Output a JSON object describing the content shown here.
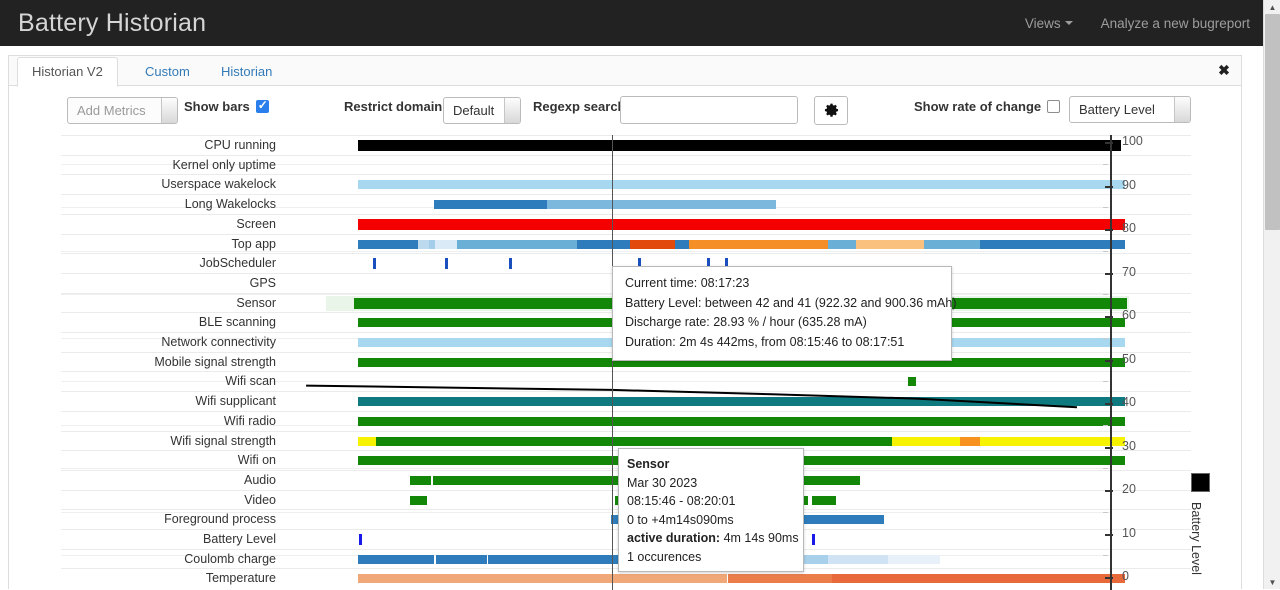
{
  "navbar": {
    "brand": "Battery Historian",
    "views_label": "Views",
    "analyze_label": "Analyze a new bugreport"
  },
  "tabs": [
    {
      "label": "Historian V2",
      "active": true
    },
    {
      "label": "Custom",
      "active": false
    },
    {
      "label": "Historian",
      "active": false
    }
  ],
  "close_label": "✖",
  "toolbar": {
    "add_metrics_label": "Add Metrics",
    "show_bars_label": "Show bars",
    "show_bars_checked": true,
    "restrict_domain_label": "Restrict domain",
    "restrict_domain_value": "Default",
    "regexp_search_label": "Regexp search",
    "regexp_search_value": "",
    "regexp_search_placeholder": "",
    "settings_icon": "gear-icon",
    "show_rate_label": "Show rate of change",
    "show_rate_checked": false,
    "metric_select_value": "Battery Level"
  },
  "legend": {
    "series_label": "Battery Level",
    "swatch_color": "#000000"
  },
  "tooltip_time": {
    "lines": [
      "Current time: 08:17:23",
      "Battery Level: between 42 and 41 (922.32 and 900.36 mAh)",
      "Discharge rate: 28.93 % / hour (635.28 mA)",
      "Duration: 2m 4s 442ms, from 08:15:46 to 08:17:51"
    ]
  },
  "tooltip_sensor": {
    "title": "Sensor",
    "date": "Mar 30 2023",
    "range": "08:15:46 - 08:20:01",
    "offset": "0 to +4m14s090ms",
    "active_duration_label": "active duration:",
    "active_duration_value": "4m 14s 90ms",
    "occurrences": "1 occurences"
  },
  "chart_data": {
    "type": "timeline",
    "title": "Battery Historian V2 timeline",
    "date": "Mar 30 2023",
    "current_time": "08:17:23",
    "cursor_time": "08:17:23",
    "yaxis": {
      "label": "Battery Level",
      "ticks": [
        100,
        90,
        80,
        70,
        60,
        50,
        40,
        30,
        20,
        10,
        0
      ],
      "ylim": [
        0,
        100
      ],
      "grid": true
    },
    "battery_level_series": {
      "name": "Battery Level",
      "color": "#000000",
      "points": [
        {
          "x": 0.04,
          "level": 44
        },
        {
          "x": 0.42,
          "level": 43
        },
        {
          "x": 0.62,
          "level": 42
        },
        {
          "x": 0.8,
          "level": 41
        },
        {
          "x": 1.0,
          "level": 39
        }
      ]
    },
    "rows": [
      {
        "label": "CPU running",
        "segments": [
          {
            "start": 0.04,
            "end": 0.99,
            "color": "#000000",
            "tall": true
          }
        ]
      },
      {
        "label": "Kernel only uptime",
        "segments": []
      },
      {
        "label": "Userspace wakelock",
        "segments": [
          {
            "start": 0.04,
            "end": 0.995,
            "color": "#a8d8f0"
          }
        ]
      },
      {
        "label": "Long Wakelocks",
        "segments": [
          {
            "start": 0.135,
            "end": 0.275,
            "color": "#2e7cbb"
          },
          {
            "start": 0.275,
            "end": 0.56,
            "color": "#7cb8dd"
          }
        ]
      },
      {
        "label": "Screen",
        "segments": [
          {
            "start": 0.04,
            "end": 0.995,
            "color": "#f40000",
            "tall": true
          }
        ]
      },
      {
        "label": "Top app",
        "segments": [
          {
            "start": 0.04,
            "end": 0.115,
            "color": "#2e7cbb"
          },
          {
            "start": 0.115,
            "end": 0.128,
            "color": "#bcd9ee"
          },
          {
            "start": 0.128,
            "end": 0.136,
            "color": "#a3cde8"
          },
          {
            "start": 0.136,
            "end": 0.163,
            "color": "#dbeaf7"
          },
          {
            "start": 0.163,
            "end": 0.313,
            "color": "#6aafd6"
          },
          {
            "start": 0.313,
            "end": 0.378,
            "color": "#2e7cbb"
          },
          {
            "start": 0.378,
            "end": 0.435,
            "color": "#e24a0d"
          },
          {
            "start": 0.435,
            "end": 0.452,
            "color": "#2e7cbb"
          },
          {
            "start": 0.452,
            "end": 0.625,
            "color": "#f58e27"
          },
          {
            "start": 0.625,
            "end": 0.66,
            "color": "#6aafd6"
          },
          {
            "start": 0.66,
            "end": 0.745,
            "color": "#fac07d"
          },
          {
            "start": 0.745,
            "end": 0.815,
            "color": "#6aafd6"
          },
          {
            "start": 0.815,
            "end": 0.995,
            "color": "#2e7cbb"
          }
        ]
      },
      {
        "label": "JobScheduler",
        "segments": [
          {
            "start": 0.059,
            "end": 0.062,
            "color": "#1a4fbe",
            "tick": true
          },
          {
            "start": 0.148,
            "end": 0.151,
            "color": "#1a4fbe",
            "tick": true
          },
          {
            "start": 0.228,
            "end": 0.236,
            "color": "#1a4fbe",
            "tick": true
          },
          {
            "start": 0.388,
            "end": 0.391,
            "color": "#1a4fbe",
            "tick": true
          },
          {
            "start": 0.474,
            "end": 0.477,
            "color": "#1a4fbe",
            "tick": true
          },
          {
            "start": 0.497,
            "end": 0.5,
            "color": "#1a4fbe",
            "tick": true
          }
        ]
      },
      {
        "label": "GPS",
        "segments": [
          {
            "start": 0.575,
            "end": 0.655,
            "color": "#f40000"
          }
        ]
      },
      {
        "label": "Sensor",
        "segments": [
          {
            "start": 0.035,
            "end": 0.997,
            "color": "#138808",
            "tall": true
          }
        ],
        "highlighted": true
      },
      {
        "label": "BLE scanning",
        "segments": [
          {
            "start": 0.04,
            "end": 0.995,
            "color": "#138808"
          }
        ]
      },
      {
        "label": "Network connectivity",
        "segments": [
          {
            "start": 0.04,
            "end": 0.995,
            "color": "#a8d8f0"
          }
        ]
      },
      {
        "label": "Mobile signal strength",
        "segments": [
          {
            "start": 0.04,
            "end": 0.995,
            "color": "#138808"
          }
        ]
      },
      {
        "label": "Wifi scan",
        "segments": [
          {
            "start": 0.725,
            "end": 0.735,
            "color": "#138808"
          }
        ]
      },
      {
        "label": "Wifi supplicant",
        "segments": [
          {
            "start": 0.04,
            "end": 0.5,
            "color": "#f40000"
          },
          {
            "start": 0.04,
            "end": 0.995,
            "color": "#0e7a80"
          }
        ]
      },
      {
        "label": "Wifi radio",
        "segments": [
          {
            "start": 0.04,
            "end": 0.995,
            "color": "#138808"
          }
        ]
      },
      {
        "label": "Wifi signal strength",
        "segments": [
          {
            "start": 0.04,
            "end": 0.062,
            "color": "#f7f200"
          },
          {
            "start": 0.062,
            "end": 0.705,
            "color": "#138808"
          },
          {
            "start": 0.705,
            "end": 0.79,
            "color": "#f7f200"
          },
          {
            "start": 0.79,
            "end": 0.815,
            "color": "#f79221"
          },
          {
            "start": 0.815,
            "end": 0.995,
            "color": "#f7f200"
          }
        ]
      },
      {
        "label": "Wifi on",
        "segments": [
          {
            "start": 0.04,
            "end": 0.995,
            "color": "#138808"
          }
        ]
      },
      {
        "label": "Audio",
        "segments": [
          {
            "start": 0.105,
            "end": 0.131,
            "color": "#138808"
          },
          {
            "start": 0.133,
            "end": 0.665,
            "color": "#138808"
          }
        ]
      },
      {
        "label": "Video",
        "segments": [
          {
            "start": 0.104,
            "end": 0.126,
            "color": "#138808"
          },
          {
            "start": 0.36,
            "end": 0.555,
            "color": "#138808"
          },
          {
            "start": 0.585,
            "end": 0.6,
            "color": "#138808"
          },
          {
            "start": 0.605,
            "end": 0.635,
            "color": "#138808"
          }
        ]
      },
      {
        "label": "Foreground process",
        "segments": [
          {
            "start": 0.355,
            "end": 0.695,
            "color": "#2e7cbb"
          }
        ]
      },
      {
        "label": "Battery Level",
        "segments": [
          {
            "start": 0.041,
            "end": 0.045,
            "color": "#1a1ae8",
            "tick": true
          },
          {
            "start": 0.4,
            "end": 0.403,
            "color": "#1a1ae8",
            "tick": true
          },
          {
            "start": 0.605,
            "end": 0.608,
            "color": "#1a1ae8",
            "tick": true
          }
        ]
      },
      {
        "label": "Coulomb charge",
        "segments": [
          {
            "start": 0.04,
            "end": 0.135,
            "color": "#2e7cbb"
          },
          {
            "start": 0.137,
            "end": 0.2,
            "color": "#2e7cbb"
          },
          {
            "start": 0.202,
            "end": 0.5,
            "color": "#2e7cbb"
          },
          {
            "start": 0.5,
            "end": 0.535,
            "color": "#a8d0ea"
          },
          {
            "start": 0.537,
            "end": 0.575,
            "color": "#a8d0ea"
          },
          {
            "start": 0.577,
            "end": 0.625,
            "color": "#a8d0ea"
          },
          {
            "start": 0.625,
            "end": 0.7,
            "color": "#cfe3f4"
          },
          {
            "start": 0.7,
            "end": 0.765,
            "color": "#e8f1fa"
          }
        ]
      },
      {
        "label": "Temperature",
        "segments": [
          {
            "start": 0.04,
            "end": 0.5,
            "color": "#f0a878"
          },
          {
            "start": 0.5,
            "end": 0.63,
            "color": "#ea7d4a"
          },
          {
            "start": 0.63,
            "end": 0.995,
            "color": "#e8693a"
          }
        ]
      }
    ]
  },
  "scrollbar": {
    "up_arrow": "▲",
    "down_arrow": "▼"
  }
}
